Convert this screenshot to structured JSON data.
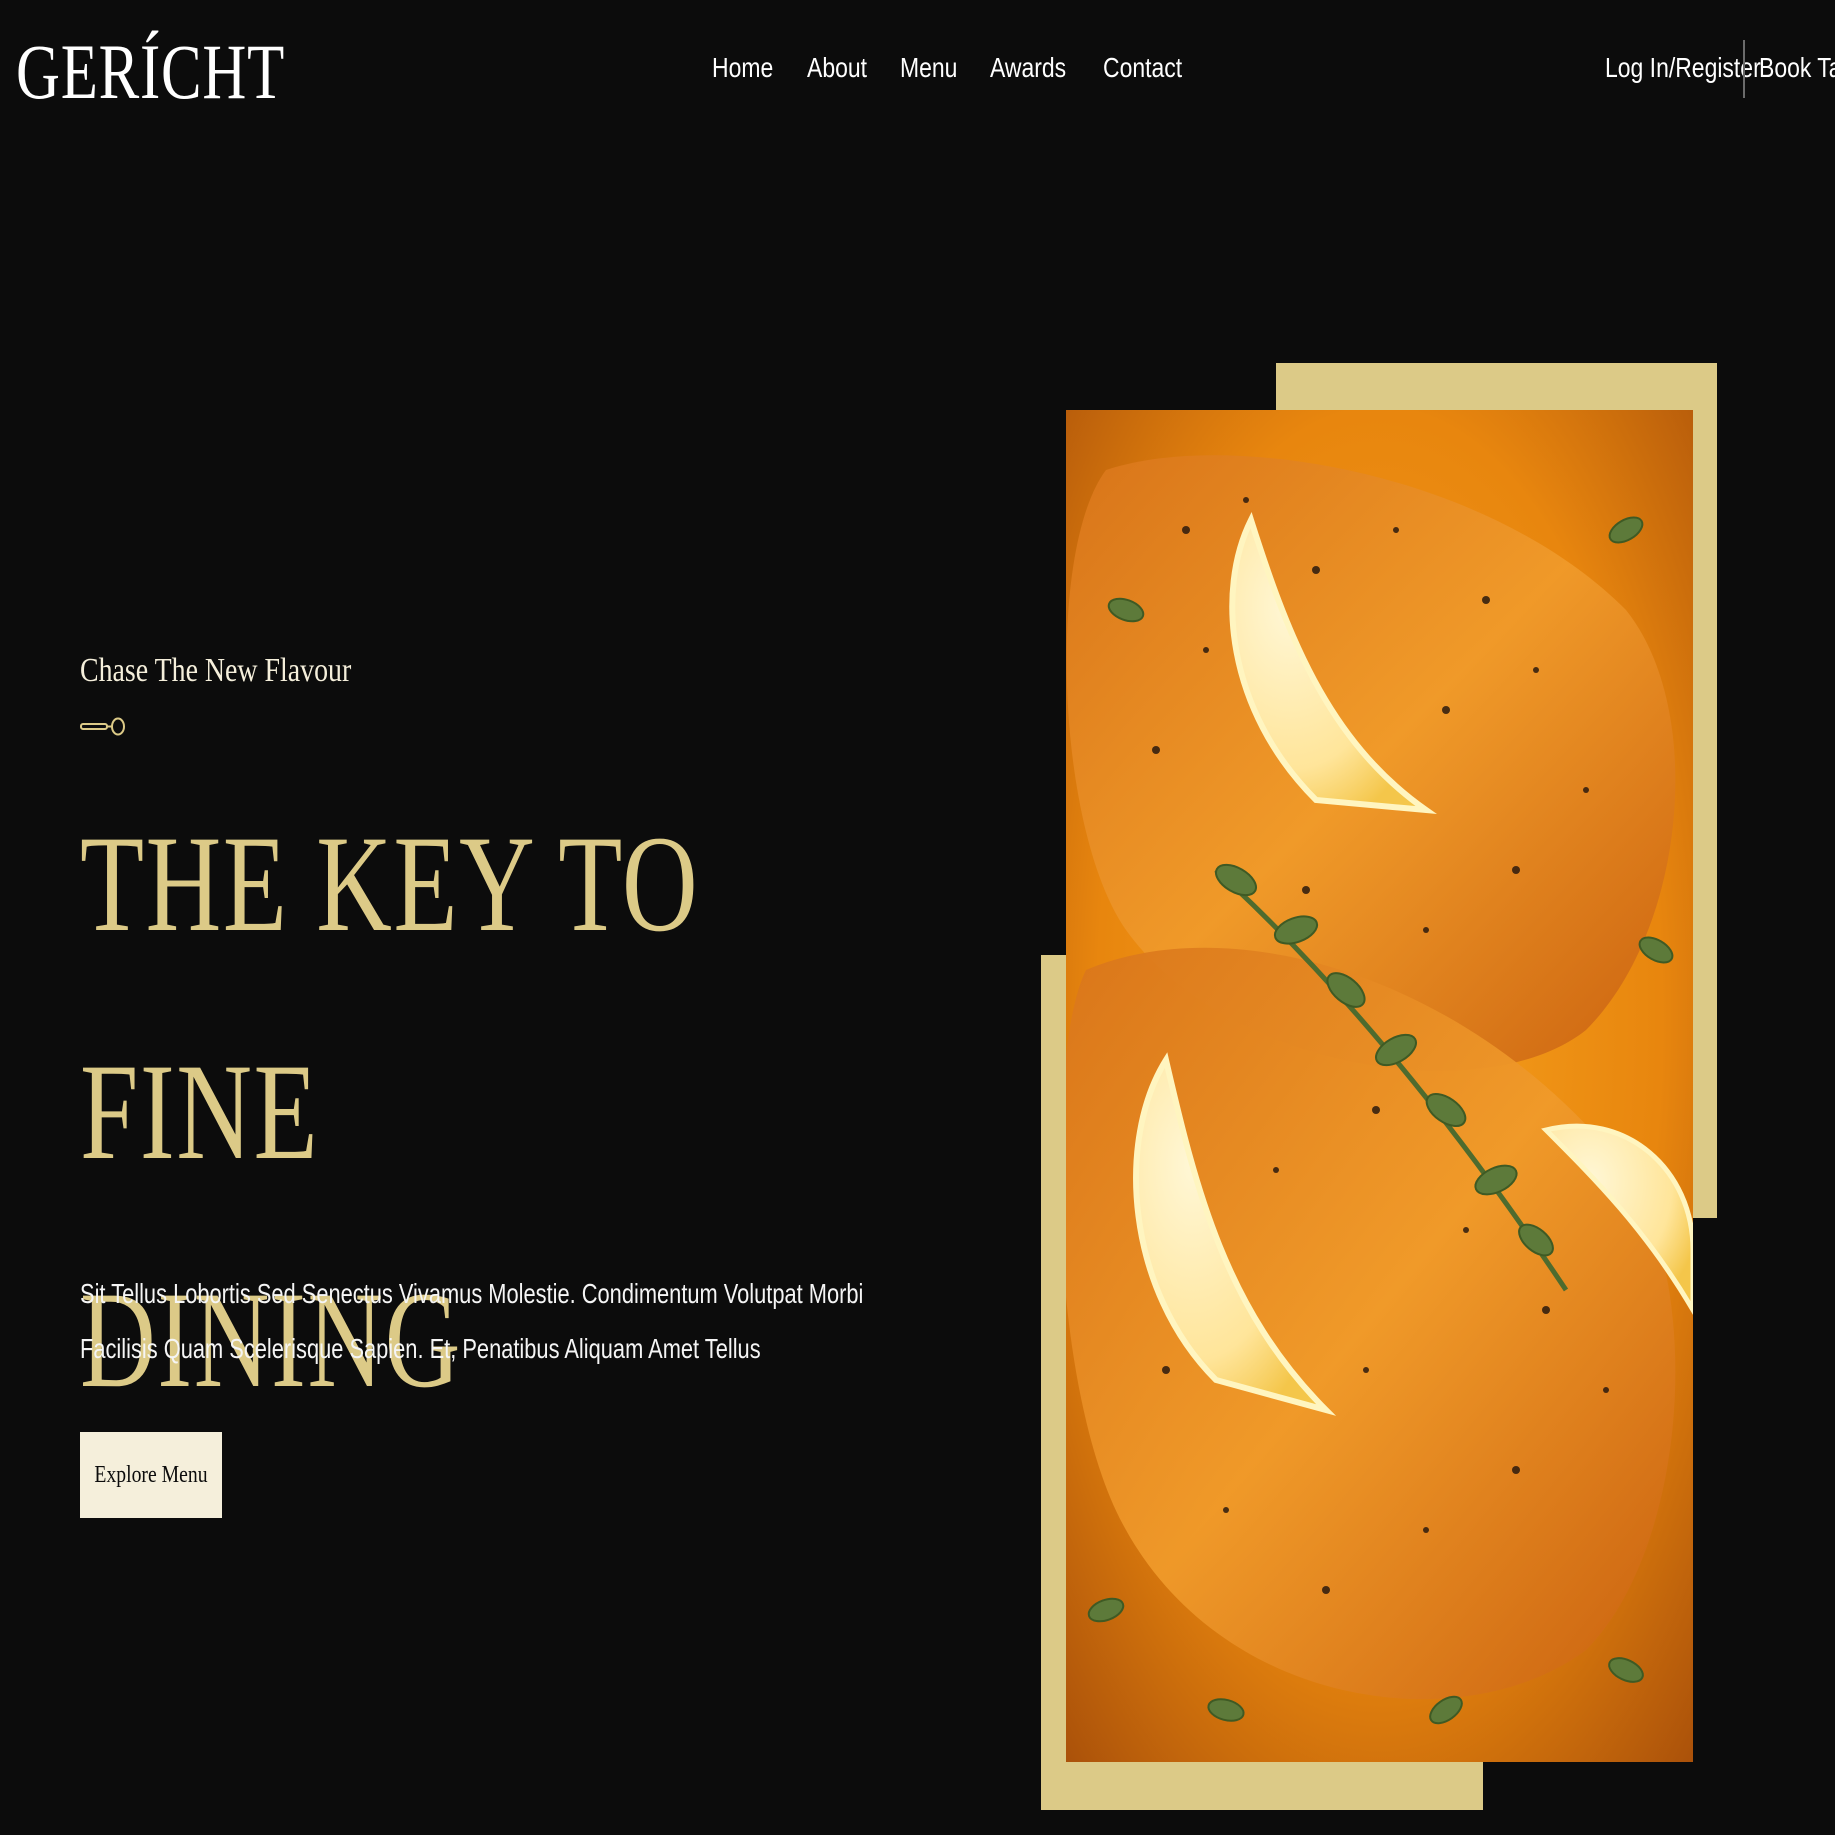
{
  "brand": {
    "logo": "GERÍCHT"
  },
  "nav": {
    "links": [
      "Home",
      "About",
      "Menu",
      "Awards",
      "Contact"
    ],
    "login": "Log In/Register",
    "book": "Book Table"
  },
  "hero": {
    "subtitle": "Chase The New Flavour",
    "title_line1": "THE KEY TO FINE",
    "title_line2": "DINING",
    "description": "Sit Tellus Lobortis Sed Senectus Vivamus Molestie. Condimentum Volutpat Morbi Facilisis Quam Scelerisque Sapien. Et, Penatibus Aliquam Amet Tellus",
    "button_label": "Explore Menu"
  },
  "colors": {
    "background": "#0c0c0c",
    "gold": "#dcca87",
    "cream": "#f5efdb",
    "white": "#ffffff"
  },
  "icons": [
    "spoon-icon"
  ]
}
